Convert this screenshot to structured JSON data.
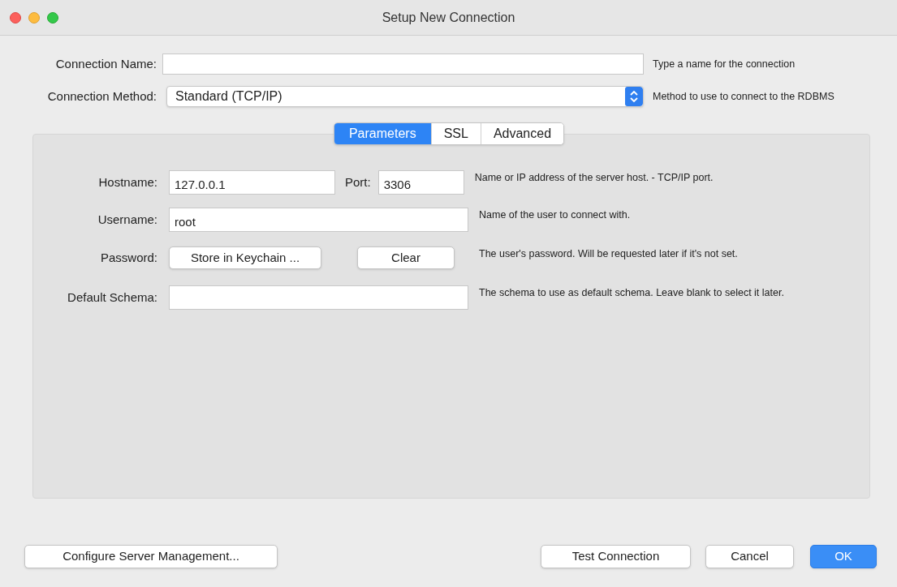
{
  "window": {
    "title": "Setup New Connection"
  },
  "connection_name": {
    "label": "Connection Name:",
    "hint": "Type a name for the connection"
  },
  "connection_method": {
    "label": "Connection Method:",
    "value": "Standard (TCP/IP)",
    "hint": "Method to use to connect to the RDBMS"
  },
  "tabs": [
    {
      "label": "Parameters",
      "selected": true
    },
    {
      "label": "SSL",
      "selected": false
    },
    {
      "label": "Advanced",
      "selected": false
    }
  ],
  "parameters": {
    "hostname": {
      "label": "Hostname:",
      "value": "127.0.0.1"
    },
    "port": {
      "label": "Port:",
      "value": "3306"
    },
    "hostname_hint": "Name or IP address of the server host. - TCP/IP port.",
    "username": {
      "label": "Username:",
      "value": "root",
      "hint": "Name of the user to connect with."
    },
    "password": {
      "label": "Password:",
      "buttons": [
        "Store in Keychain ...",
        "Clear"
      ],
      "hint": "The user's password. Will be requested later if it's not set."
    },
    "default_schema": {
      "label": "Default Schema:",
      "hint": "The schema to use as default schema. Leave blank to select it later."
    }
  },
  "buttons": [
    {
      "label": "Configure Server Management...",
      "primary": false
    },
    {
      "label": "Test Connection",
      "primary": false
    },
    {
      "label": "Cancel",
      "primary": false
    },
    {
      "label": "OK",
      "primary": true
    }
  ]
}
